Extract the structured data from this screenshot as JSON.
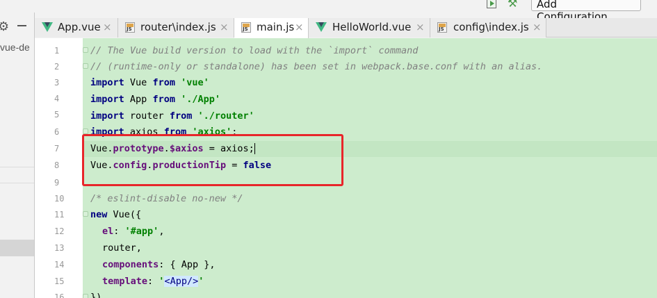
{
  "toolbar": {
    "run_icon": "run-icon",
    "build_icon": "hammer-icon",
    "add_config_label": "Add Configuration..."
  },
  "sidebar": {
    "project_text": "vue-de"
  },
  "tabs": [
    {
      "label": "App.vue",
      "icon": "vue-icon",
      "active": false
    },
    {
      "label": "router\\index.js",
      "icon": "js-icon",
      "active": false
    },
    {
      "label": "main.js",
      "icon": "js-icon",
      "active": true
    },
    {
      "label": "HelloWorld.vue",
      "icon": "vue-icon",
      "active": false
    },
    {
      "label": "config\\index.js",
      "icon": "js-icon",
      "active": false
    }
  ],
  "close_glyph": "×",
  "js_badge": "JS",
  "editor": {
    "line_numbers": [
      "1",
      "2",
      "3",
      "4",
      "5",
      "6",
      "7",
      "8",
      "9",
      "10",
      "11",
      "12",
      "13",
      "14",
      "15",
      "16"
    ],
    "lines": {
      "l1": "// The Vue build version to load with the `import` command",
      "l2": "// (runtime-only or standalone) has been set in webpack.base.conf with an alias.",
      "import": "import",
      "from": "from",
      "vue_name": "Vue",
      "vue_src": "'vue'",
      "app_name": "App",
      "app_src": "'./App'",
      "router_name": "router",
      "router_src": "'./router'",
      "axios_name": "axios",
      "axios_src": "'axios'",
      "l7_a": "Vue.",
      "l7_b": "prototype",
      "l7_c": ".",
      "l7_d": "$axios",
      "l7_e": " = axios;",
      "l8_a": "Vue.",
      "l8_b": "config",
      "l8_c": ".",
      "l8_d": "productionTip",
      "l8_e": " = ",
      "l8_f": "false",
      "l10": "/* eslint-disable no-new */",
      "l11_kw": "new",
      "l11_rest": " Vue({",
      "l12_key": "el",
      "l12_val": "'#app'",
      "l13": "router,",
      "l14_key": "components",
      "l14_rest": ": { App },",
      "l15_key": "template",
      "l15_q1": "'",
      "l15_tag": "<App/>",
      "l15_q2": "'",
      "l16": "})"
    }
  },
  "colors": {
    "highlight_box": "#e8252a",
    "diff_background": "#cdeccd"
  }
}
